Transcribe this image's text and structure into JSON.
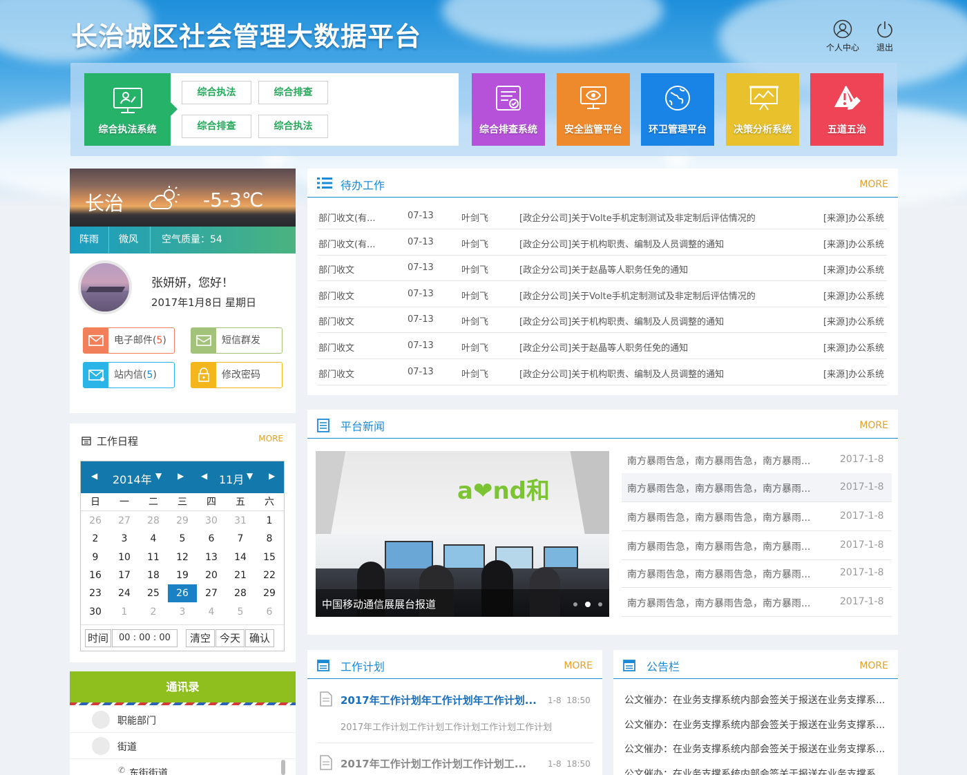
{
  "header": {
    "title": "长治城区社会管理大数据平台",
    "user_center": "个人中心",
    "logout": "退出"
  },
  "nav": {
    "main_system": "综合执法系统",
    "sub_links": [
      "综合执法",
      "综合排查",
      "综合排查",
      "综合执法"
    ],
    "tiles": [
      {
        "label": "综合排查系统",
        "color": "#b552d9",
        "icon": "checklist-icon"
      },
      {
        "label": "安全监管平台",
        "color": "#ee8a2c",
        "icon": "monitor-eye-icon"
      },
      {
        "label": "环卫管理平台",
        "color": "#1a83e6",
        "icon": "globe-icon"
      },
      {
        "label": "决策分析系统",
        "color": "#e8c12c",
        "icon": "chart-board-icon"
      },
      {
        "label": "五道五治",
        "color": "#ee4456",
        "icon": "warning-icon"
      }
    ]
  },
  "weather": {
    "city": "长治",
    "temp": "-5-3℃",
    "condition": "阵雨",
    "wind": "微风",
    "air": "空气质量：54"
  },
  "user": {
    "greeting": "张妍妍，您好！",
    "date": "2017年1月8日  星期日",
    "email_label": "电子邮件(",
    "email_count": "5",
    "sms_label": "短信群发",
    "inbox_label": "站内信(",
    "inbox_count": "5",
    "close_paren": ")",
    "password_label": "修改密码"
  },
  "schedule": {
    "title": "工作日程",
    "more": "MORE",
    "year": "2014年",
    "month": "11月",
    "weekdays": [
      "日",
      "一",
      "二",
      "三",
      "四",
      "五",
      "六"
    ],
    "days": [
      [
        "26",
        "27",
        "28",
        "29",
        "30",
        "31",
        "1"
      ],
      [
        "2",
        "3",
        "4",
        "5",
        "6",
        "7",
        "8"
      ],
      [
        "9",
        "10",
        "11",
        "12",
        "13",
        "14",
        "15"
      ],
      [
        "16",
        "17",
        "18",
        "19",
        "20",
        "21",
        "22"
      ],
      [
        "23",
        "24",
        "25",
        "26",
        "27",
        "28",
        "29"
      ],
      [
        "30",
        "1",
        "2",
        "3",
        "4",
        "5",
        "6"
      ]
    ],
    "selected_day": "26",
    "time_label": "时间",
    "time_value": "00 : 00 : 00",
    "clear": "清空",
    "today": "今天",
    "confirm": "确认"
  },
  "contacts": {
    "title": "通讯录",
    "items": [
      "职能部门",
      "街道",
      "东街街道"
    ]
  },
  "todo": {
    "title": "待办工作",
    "more": "MORE",
    "rows": [
      {
        "type": "部门收文(有...",
        "date": "07-13",
        "person": "叶剑飞",
        "subject": "[政企分公司]关于Volte手机定制测试及非定制后评估情况的",
        "source": "[来源]办公系统"
      },
      {
        "type": "部门收文(有...",
        "date": "07-13",
        "person": "叶剑飞",
        "subject": "[政企分公司]关于机构职责、编制及人员调整的通知",
        "source": "[来源]办公系统"
      },
      {
        "type": "部门收文",
        "date": "07-13",
        "person": "叶剑飞",
        "subject": "[政企分公司]关于赵晶等人职务任免的通知",
        "source": "[来源]办公系统"
      },
      {
        "type": "部门收文",
        "date": "07-13",
        "person": "叶剑飞",
        "subject": "[政企分公司]关于Volte手机定制测试及非定制后评估情况的",
        "source": "[来源]办公系统"
      },
      {
        "type": "部门收文",
        "date": "07-13",
        "person": "叶剑飞",
        "subject": "[政企分公司]关于机构职责、编制及人员调整的通知",
        "source": "[来源]办公系统"
      },
      {
        "type": "部门收文",
        "date": "07-13",
        "person": "叶剑飞",
        "subject": "[政企分公司]关于赵晶等人职务任免的通知",
        "source": "[来源]办公系统"
      },
      {
        "type": "部门收文",
        "date": "07-13",
        "person": "叶剑飞",
        "subject": "[政企分公司]关于机构职责、编制及人员调整的通知",
        "source": "[来源]办公系统"
      }
    ]
  },
  "news": {
    "title": "平台新闻",
    "more": "MORE",
    "caption": "中国移动通信展展台报道",
    "items": [
      {
        "text": "南方暴雨告急，南方暴雨告急，南方暴雨...",
        "date": "2017-1-8"
      },
      {
        "text": "南方暴雨告急，南方暴雨告急，南方暴雨...",
        "date": "2017-1-8"
      },
      {
        "text": "南方暴雨告急，南方暴雨告急，南方暴雨...",
        "date": "2017-1-8"
      },
      {
        "text": "南方暴雨告急，南方暴雨告急，南方暴雨...",
        "date": "2017-1-8"
      },
      {
        "text": "南方暴雨告急，南方暴雨告急，南方暴雨...",
        "date": "2017-1-8"
      },
      {
        "text": "南方暴雨告急，南方暴雨告急，南方暴雨...",
        "date": "2017-1-8"
      }
    ]
  },
  "plan": {
    "title": "工作计划",
    "more": "MORE",
    "items": [
      {
        "title": "2017年工作计划年工作计划年工作计划...",
        "time": "1-8  18:50",
        "desc": "2017年工作计划工作计划工作计划工作计划工作计划"
      },
      {
        "title": "2017年工作计划工作计划工作计划工...",
        "time": "1-8  18:50"
      }
    ]
  },
  "bulletin": {
    "title": "公告栏",
    "more": "MORE",
    "items": [
      "公文催办：在业务支撑系统内部会签关于报送在业务支撑系...",
      "公文催办：在业务支撑系统内部会签关于报送在业务支撑系...",
      "公文催办：在业务支撑系统内部会签关于报送在业务支撑系...",
      "公文催办：在业务支撑系统内部会签关于报送在业务支撑系..."
    ]
  }
}
